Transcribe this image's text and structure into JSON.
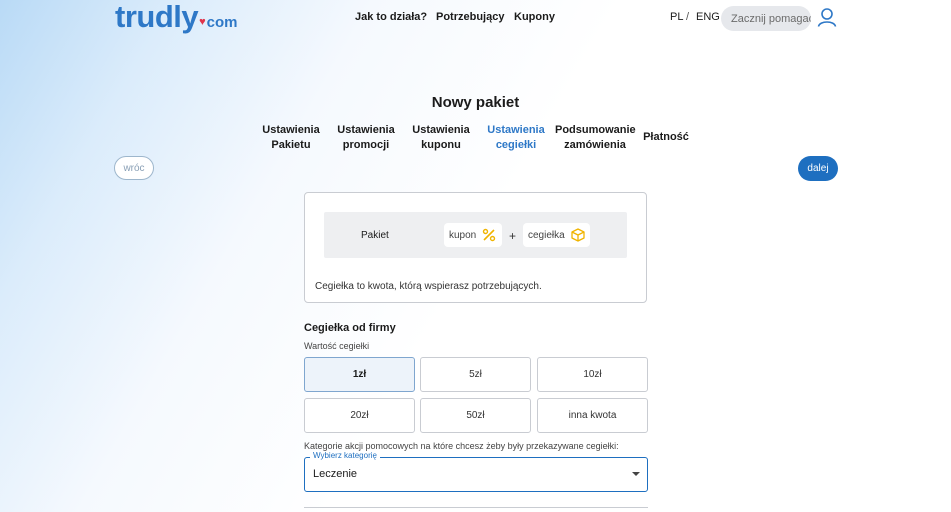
{
  "header": {
    "logo_text": "trudly",
    "logo_heart": "♥",
    "logo_domain": "com",
    "nav": [
      "Jak to działa?",
      "Potrzebujący",
      "Kupony"
    ],
    "lang_pl": "PL",
    "lang_sep": "/",
    "lang_eng": "ENG",
    "search_placeholder": "Zacznij pomagać",
    "user_icon": "user-icon"
  },
  "page": {
    "title": "Nowy pakiet",
    "steps": [
      {
        "label": "Ustawienia Pakietu",
        "active": false
      },
      {
        "label": "Ustawienia promocji",
        "active": false
      },
      {
        "label": "Ustawienia kuponu",
        "active": false
      },
      {
        "label": "Ustawienia cegiełki",
        "active": true
      },
      {
        "label": "Podsumowanie zamówienia",
        "active": false
      },
      {
        "label": "Płatność",
        "active": false
      }
    ],
    "back_label": "wróc",
    "next_label": "dalej"
  },
  "summary": {
    "package_label": "Pakiet",
    "coupon_chip": "kupon",
    "plus": "+",
    "brick_chip": "cegiełka",
    "description": "Cegiełka to kwota, którą wspierasz potrzebujących."
  },
  "brick": {
    "section_title": "Cegiełka od firmy",
    "value_label": "Wartość cegiełki",
    "options": [
      "1zł",
      "5zł",
      "10zł",
      "20zł",
      "50zł",
      "inna kwota"
    ],
    "selected": "1zł",
    "category_question": "Kategorie akcji pomocowych na które chcesz żeby były przekazywane cegiełki:",
    "category_legend": "Wybierz kategorię",
    "category_value": "Leczenie"
  },
  "colors": {
    "brand": "#2e78c7",
    "accent_button": "#1e6fc0",
    "heart": "#e0344b",
    "chip_icon": "#f0b400"
  }
}
